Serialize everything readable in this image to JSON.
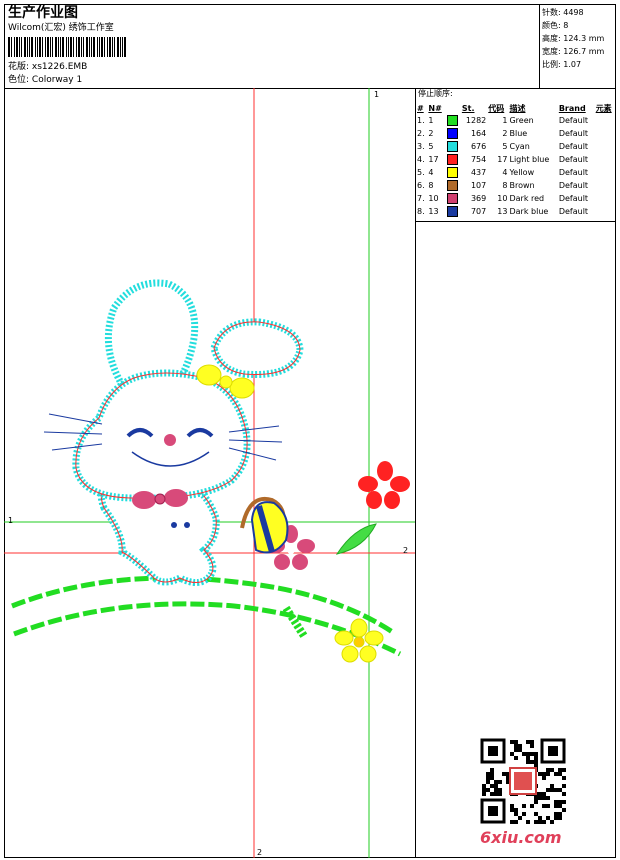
{
  "header": {
    "title": "生产作业图",
    "company": "Wilcom(汇宏) 绣饰工作室",
    "pattern_label": "花版:",
    "pattern_value": "xs1226.EMB",
    "colorway_label": "色位:",
    "colorway_value": "Colorway 1"
  },
  "stats": [
    {
      "label": "针数:",
      "value": "4498"
    },
    {
      "label": "颜色:",
      "value": "8"
    },
    {
      "label": "高度:",
      "value": "124.3 mm"
    },
    {
      "label": "宽度:",
      "value": "126.7 mm"
    },
    {
      "label": "比例:",
      "value": "1.07"
    }
  ],
  "sequence": {
    "title": "停止顺序:",
    "headers": [
      "#",
      "N#",
      "St.",
      "代码",
      "描述",
      "Brand",
      "元素"
    ],
    "rows": [
      {
        "idx": "1.",
        "n": "1",
        "color": "#22dd22",
        "st": "1282",
        "code": "1",
        "desc": "Green",
        "brand": "Default"
      },
      {
        "idx": "2.",
        "n": "2",
        "color": "#0000ff",
        "st": "164",
        "code": "2",
        "desc": "Blue",
        "brand": "Default"
      },
      {
        "idx": "3.",
        "n": "5",
        "color": "#22dddd",
        "st": "676",
        "code": "5",
        "desc": "Cyan",
        "brand": "Default"
      },
      {
        "idx": "4.",
        "n": "17",
        "color": "#ff2020",
        "st": "754",
        "code": "17",
        "desc": "Light blue",
        "brand": "Default"
      },
      {
        "idx": "5.",
        "n": "4",
        "color": "#ffff00",
        "st": "437",
        "code": "4",
        "desc": "Yellow",
        "brand": "Default"
      },
      {
        "idx": "6.",
        "n": "8",
        "color": "#b06a2a",
        "st": "107",
        "code": "8",
        "desc": "Brown",
        "brand": "Default"
      },
      {
        "idx": "7.",
        "n": "10",
        "color": "#d04070",
        "st": "369",
        "code": "10",
        "desc": "Dark red",
        "brand": "Default"
      },
      {
        "idx": "8.",
        "n": "13",
        "color": "#1a3aa0",
        "st": "707",
        "code": "13",
        "desc": "Dark blue",
        "brand": "Default"
      }
    ]
  },
  "guides": {
    "v1": "1",
    "h1": "1",
    "h2": "2",
    "v2": "2"
  },
  "watermark": "6xiu.com"
}
